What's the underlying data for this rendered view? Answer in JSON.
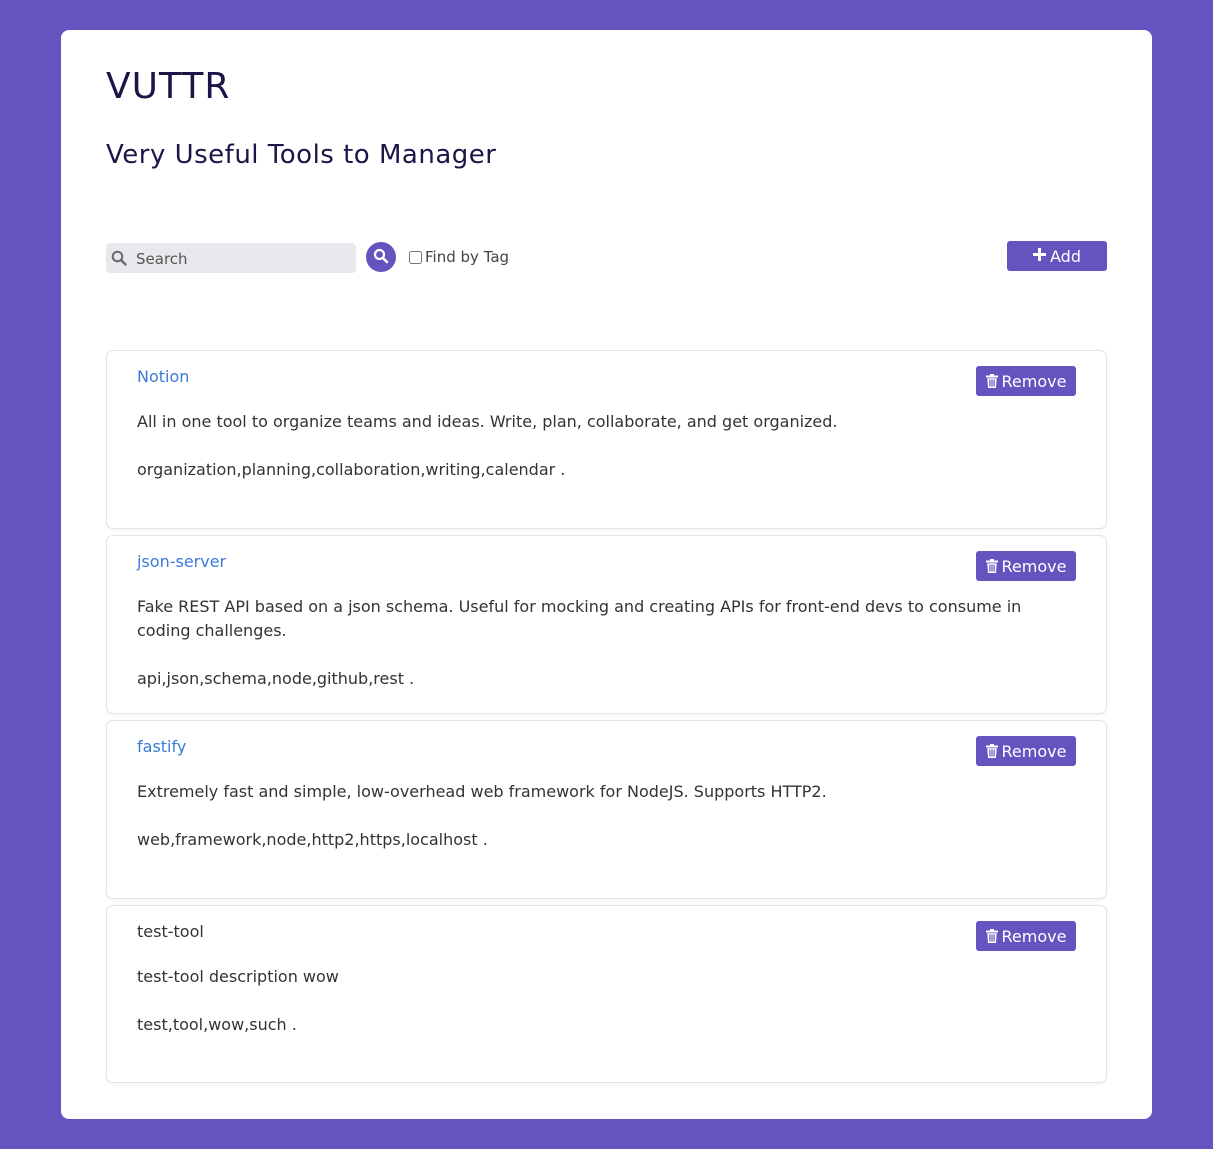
{
  "header": {
    "title": "VUTTR",
    "subtitle": "Very Useful Tools to Manager"
  },
  "toolbar": {
    "search_placeholder": "Search",
    "search_value": "",
    "find_by_tag_label": "Find by Tag",
    "find_by_tag_checked": false,
    "add_label": "Add"
  },
  "tools": [
    {
      "title": "Notion",
      "linked": true,
      "description": "All in one tool to organize teams and ideas. Write, plan, collaborate, and get organized.",
      "tags": "organization,planning,collaboration,writing,calendar .",
      "remove_label": "Remove"
    },
    {
      "title": "json-server",
      "linked": true,
      "description": "Fake REST API based on a json schema. Useful for mocking and creating APIs for front-end devs to consume in coding challenges.",
      "tags": "api,json,schema,node,github,rest .",
      "remove_label": "Remove"
    },
    {
      "title": "fastify",
      "linked": true,
      "description": "Extremely fast and simple, low-overhead web framework for NodeJS. Supports HTTP2.",
      "tags": "web,framework,node,http2,https,localhost .",
      "remove_label": "Remove"
    },
    {
      "title": "test-tool",
      "linked": false,
      "description": "test-tool description wow",
      "tags": "test,tool,wow,such .",
      "remove_label": "Remove"
    }
  ],
  "colors": {
    "background": "#6553c0",
    "accent": "#6553c0",
    "link": "#3a7bd5",
    "heading": "#1d1547"
  },
  "icons": {
    "search": "search-icon",
    "add": "plus-icon",
    "remove": "trash-icon"
  }
}
